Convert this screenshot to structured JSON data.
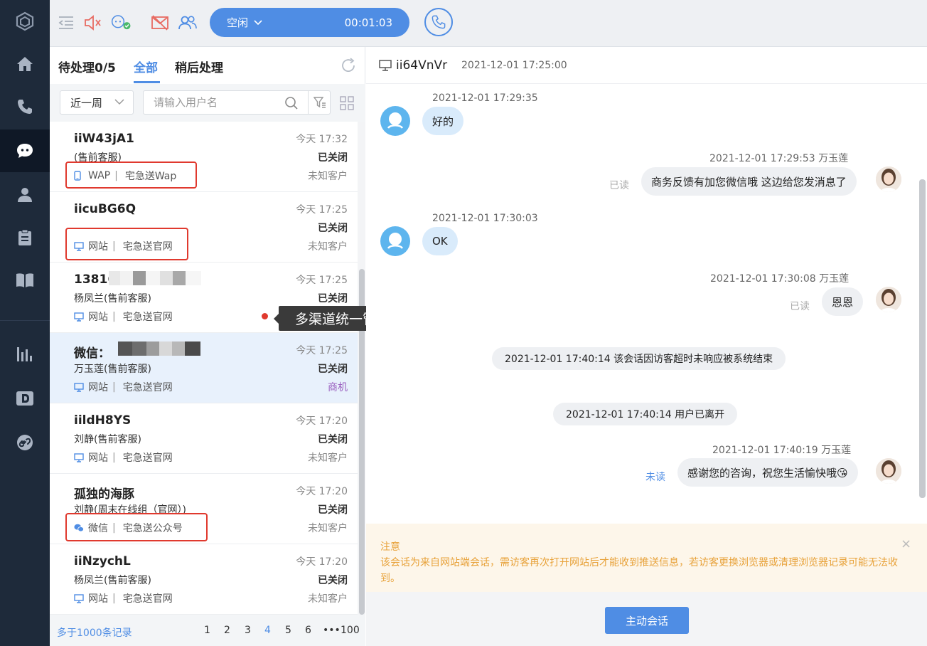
{
  "topbar": {
    "status_label": "空闲",
    "timer": "00:01:03"
  },
  "list": {
    "tabs": [
      "待处理0/5",
      "全部",
      "稍后处理"
    ],
    "active_tab": 1,
    "period_select": "近一周",
    "search_placeholder": "请输入用户名",
    "items": [
      {
        "name": "iiW43jA1",
        "sub": "(售前客服)",
        "channel_type": "WAP",
        "channel_icon": "mobile-icon",
        "source": "宅急送Wap",
        "time": "今天 17:32",
        "state": "已关闭",
        "customer": "未知客户"
      },
      {
        "name": "iicuBG6Q",
        "sub": "",
        "channel_type": "网站",
        "channel_icon": "monitor-icon",
        "source": "宅急送官网",
        "time": "今天 17:25",
        "state": "已关闭",
        "customer": "未知客户"
      },
      {
        "name": "13816",
        "sub": "杨凤兰(售前客服)",
        "channel_type": "网站",
        "channel_icon": "monitor-icon",
        "source": "宅急送官网",
        "time": "今天 17:25",
        "state": "已关闭",
        "customer": ""
      },
      {
        "name": "微信：",
        "sub": "万玉莲(售前客服)",
        "channel_type": "网站",
        "channel_icon": "monitor-icon",
        "source": "宅急送官网",
        "time": "今天 17:25",
        "state": "已关闭",
        "customer": "商机"
      },
      {
        "name": "iildH8YS",
        "sub": "刘静(售前客服)",
        "channel_type": "网站",
        "channel_icon": "monitor-icon",
        "source": "宅急送官网",
        "time": "今天 17:20",
        "state": "已关闭",
        "customer": "未知客户"
      },
      {
        "name": "孤独的海豚",
        "sub": "刘静(周末在线组（官网）)",
        "channel_type": "微信",
        "channel_icon": "wechat-icon",
        "source": "宅急送公众号",
        "time": "今天 17:20",
        "state": "已关闭",
        "customer": "未知客户"
      },
      {
        "name": "iiNzychL",
        "sub": "杨凤兰(售前客服)",
        "channel_type": "网站",
        "channel_icon": "monitor-icon",
        "source": "宅急送官网",
        "time": "今天 17:20",
        "state": "已关闭",
        "customer": "未知客户"
      }
    ],
    "pager": {
      "total": "多于1000条记录",
      "pages": [
        "1",
        "2",
        "3",
        "4",
        "5",
        "6",
        "•••",
        "100"
      ],
      "active_page": "4"
    }
  },
  "tooltip": "多渠道统一管理",
  "chat": {
    "visitor_id": "ii64VnVr",
    "session_time": "2021-12-01 17:25:00",
    "messages": [
      {
        "from": "visitor",
        "time": "2021-12-01 17:29:35",
        "text": "好的"
      },
      {
        "from": "agent",
        "time": "2021-12-01 17:29:53 万玉莲",
        "text": "商务反馈有加您微信哦 这边给您发消息了",
        "read": "已读"
      },
      {
        "from": "visitor",
        "time": "2021-12-01 17:30:03",
        "text": "OK"
      },
      {
        "from": "agent",
        "time": "2021-12-01 17:30:08 万玉莲",
        "text": "恩恩",
        "read": "已读"
      },
      {
        "from": "system",
        "text": "2021-12-01 17:40:14 该会话因访客超时未响应被系统结束"
      },
      {
        "from": "system",
        "text": "2021-12-01 17:40:14 用户已离开"
      },
      {
        "from": "agent",
        "time": "2021-12-01 17:40:19 万玉莲",
        "text": "感谢您的咨询，祝您生活愉快哦😘",
        "read": "未读"
      }
    ],
    "notice_title": "注意",
    "notice_body": "该会话为来自网站端会话，需访客再次打开网站后才能收到推送信息，若访客更换浏览器或清理浏览器记录可能无法收到。",
    "start_button": "主动会话"
  },
  "colors": {
    "accent": "#4f8de4",
    "nav_bg": "#1e2a3a",
    "highlight_red": "#e0392e",
    "notice_text": "#e8a23a"
  }
}
